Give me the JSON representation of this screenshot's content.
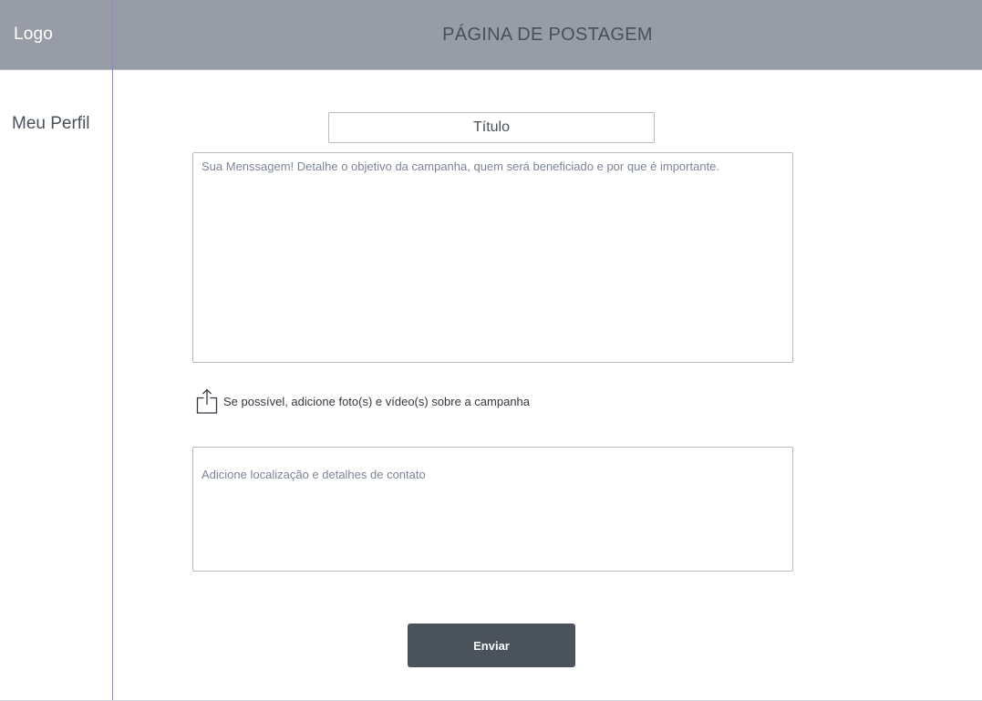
{
  "header": {
    "logo": "Logo",
    "title": "PÁGINA DE POSTAGEM"
  },
  "sidebar": {
    "profile_link": "Meu Perfil"
  },
  "form": {
    "title_placeholder": "Título",
    "message_placeholder": "Sua Menssagem! Detalhe o objetivo da campanha, quem será beneficiado e por que é importante.",
    "upload_label": "Se possível, adicione foto(s) e vídeo(s) sobre a campanha",
    "upload_icon": "share-upload-icon",
    "location_placeholder": "Adicione localização e detalhes de contato",
    "submit_label": "Enviar"
  },
  "colors": {
    "header_bg": "#979ca6",
    "button_bg": "#4a525c",
    "divider": "#8e86d0"
  }
}
